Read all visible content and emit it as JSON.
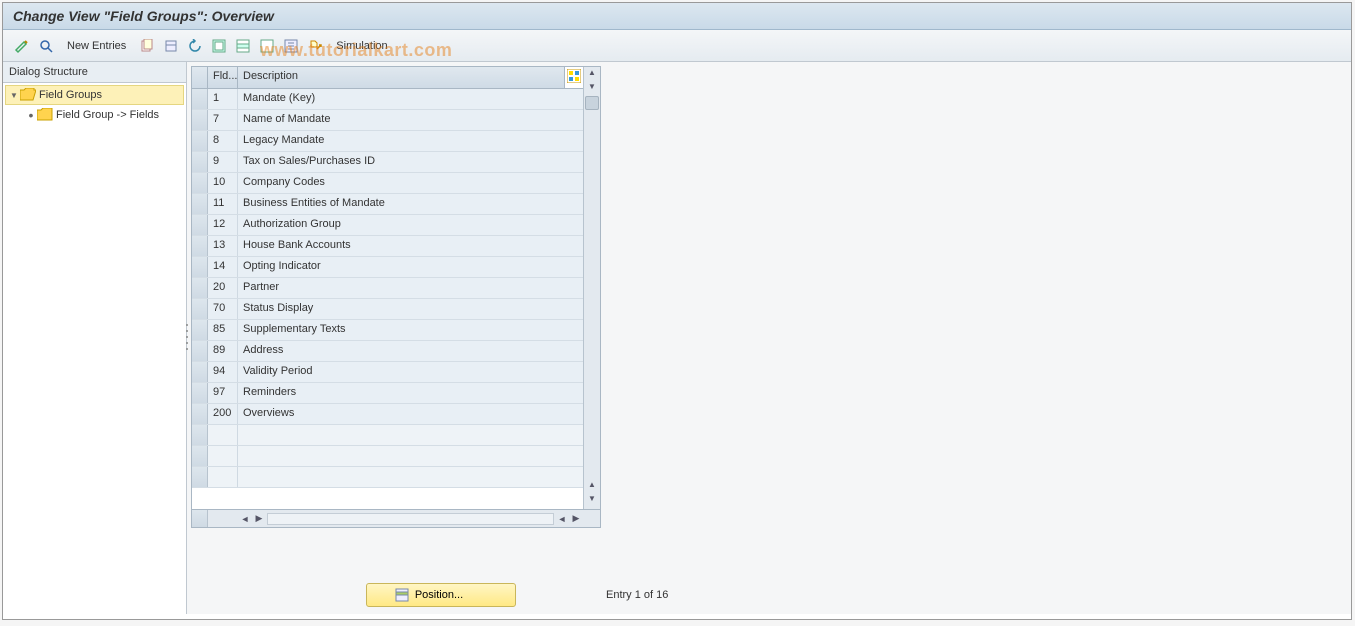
{
  "title": "Change View \"Field Groups\": Overview",
  "watermark": "www.tutorialkart.com",
  "toolbar": {
    "new_entries_label": "New Entries",
    "simulation_label": "Simulation"
  },
  "tree": {
    "header": "Dialog Structure",
    "items": [
      {
        "label": "Field Groups",
        "expanded": true,
        "selected": true,
        "level": 0,
        "folder_open": true
      },
      {
        "label": "Field Group -> Fields",
        "expanded": false,
        "selected": false,
        "level": 1,
        "folder_open": false
      }
    ]
  },
  "table": {
    "columns": {
      "fld": "Fld...",
      "description": "Description"
    },
    "rows": [
      {
        "fld": "1",
        "desc": "Mandate (Key)"
      },
      {
        "fld": "7",
        "desc": "Name of Mandate"
      },
      {
        "fld": "8",
        "desc": "Legacy Mandate"
      },
      {
        "fld": "9",
        "desc": "Tax on Sales/Purchases ID"
      },
      {
        "fld": "10",
        "desc": "Company Codes"
      },
      {
        "fld": "11",
        "desc": "Business Entities of Mandate"
      },
      {
        "fld": "12",
        "desc": "Authorization Group"
      },
      {
        "fld": "13",
        "desc": "House Bank Accounts"
      },
      {
        "fld": "14",
        "desc": "Opting Indicator"
      },
      {
        "fld": "20",
        "desc": "Partner"
      },
      {
        "fld": "70",
        "desc": "Status Display"
      },
      {
        "fld": "85",
        "desc": "Supplementary Texts"
      },
      {
        "fld": "89",
        "desc": "Address"
      },
      {
        "fld": "94",
        "desc": "Validity Period"
      },
      {
        "fld": "97",
        "desc": "Reminders"
      },
      {
        "fld": "200",
        "desc": "Overviews"
      }
    ],
    "empty_rows": 3
  },
  "footer": {
    "position_label": "Position...",
    "entry_status": "Entry 1 of 16"
  }
}
